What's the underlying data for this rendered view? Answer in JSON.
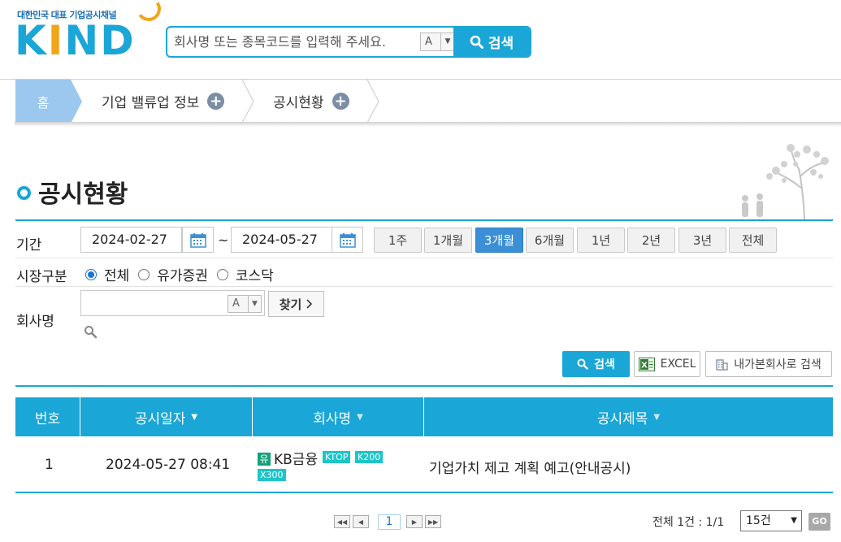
{
  "header": {
    "logo_tagline": "대한민국 대표 기업공시채널",
    "logo_text_pre": "K",
    "logo_text_i": "I",
    "logo_text_post": "ND",
    "search_placeholder": "회사명 또는 종목코드를 입력해 주세요.",
    "font_size_label": "A",
    "search_button": "검색"
  },
  "breadcrumb": {
    "home": "홈",
    "items": [
      "기업 밸류업 정보",
      "공시현황"
    ]
  },
  "page_title": "공시현황",
  "filters": {
    "period_label": "기간",
    "start_date": "2024-02-27",
    "end_date": "2024-05-27",
    "tilde": "~",
    "period_buttons": [
      "1주",
      "1개월",
      "3개월",
      "6개월",
      "1년",
      "2년",
      "3년",
      "전체"
    ],
    "period_selected": "3개월",
    "market_label": "시장구분",
    "market_options": [
      "전체",
      "유가증권",
      "코스닥"
    ],
    "market_selected": "전체",
    "company_label": "회사명",
    "company_value": "",
    "company_font_label": "A",
    "find_button": "찾기"
  },
  "actions": {
    "search": "검색",
    "excel": "EXCEL",
    "my_company": "내가본회사로 검색"
  },
  "table": {
    "headers": [
      "번호",
      "공시일자",
      "회사명",
      "공시제목"
    ],
    "rows": [
      {
        "no": "1",
        "date": "2024-05-27 08:41",
        "market_badge": "유",
        "company": "KB금융",
        "tags": [
          "KTOP",
          "K200",
          "X300"
        ],
        "title": "기업가치 제고 계획 예고(안내공시)"
      }
    ]
  },
  "pagination": {
    "current_page": "1",
    "total_text": "전체 1건 : 1/1",
    "page_size": "15건",
    "go": "GO"
  },
  "colors": {
    "accent": "#1aa6d6",
    "active_period": "#3a8fd6",
    "home_crumb": "#9cc7ee",
    "tag": "#1dc4c8",
    "market_badge": "#17a07a"
  }
}
